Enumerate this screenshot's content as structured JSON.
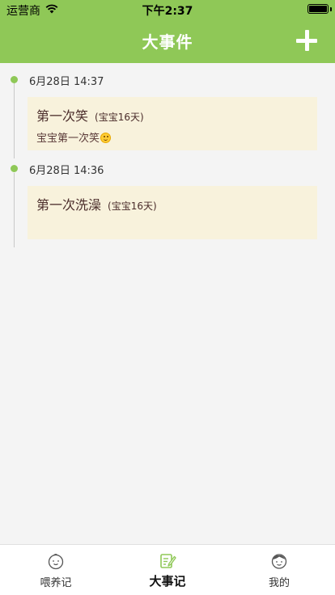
{
  "status_bar": {
    "carrier": "运营商",
    "time": "下午2:37"
  },
  "nav": {
    "title": "大事件",
    "add_icon": "plus-icon"
  },
  "colors": {
    "accent": "#8fc857",
    "card_bg": "#f8f2dc"
  },
  "events": [
    {
      "time": "6月28日 14:37",
      "title": "第一次笑",
      "age": "(宝宝16天)",
      "desc": "宝宝第一次笑"
    },
    {
      "time": "6月28日 14:36",
      "title": "第一次洗澡",
      "age": "(宝宝16天)",
      "desc": ""
    }
  ],
  "tabs": [
    {
      "label": "喂养记",
      "icon": "baby-face-icon",
      "active": false
    },
    {
      "label": "大事记",
      "icon": "notebook-pen-icon",
      "active": true
    },
    {
      "label": "我的",
      "icon": "person-face-icon",
      "active": false
    }
  ]
}
